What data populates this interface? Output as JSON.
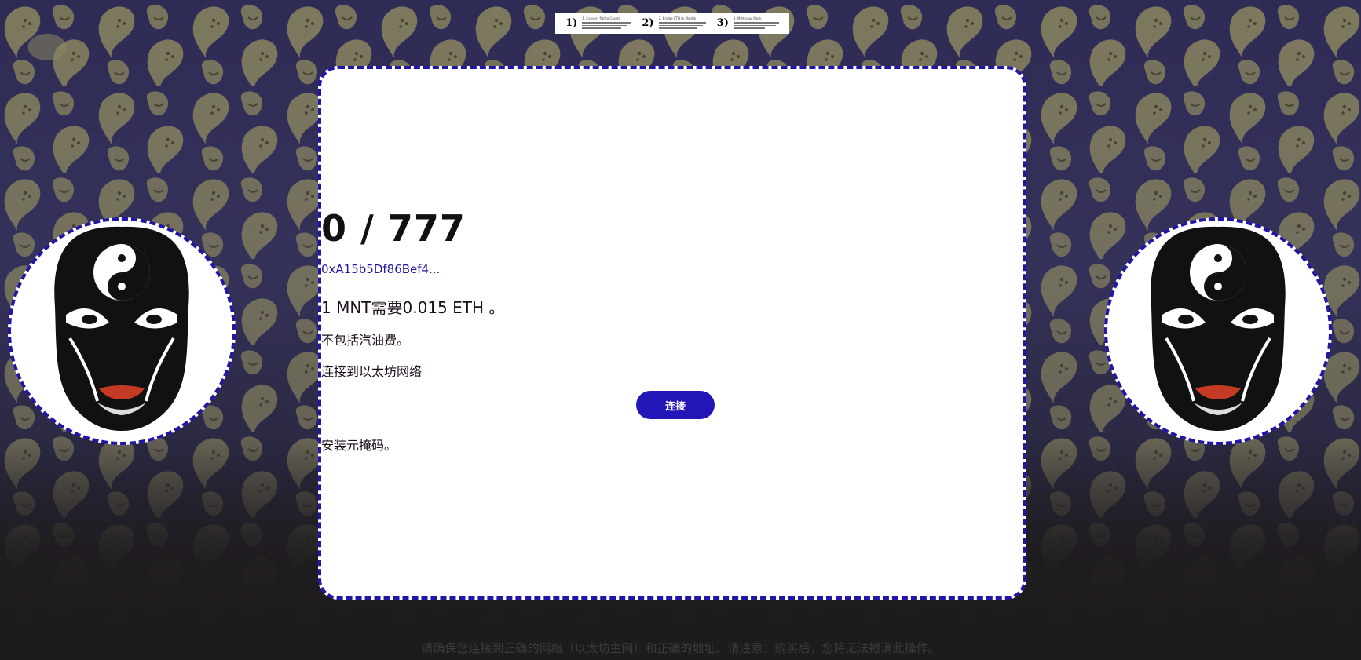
{
  "steps_banner": {
    "steps": [
      {
        "number": "1)",
        "title": "1. Convert fiat to Crypto"
      },
      {
        "number": "2)",
        "title": "2. Bridge ETH to Mantle"
      },
      {
        "number": "3)",
        "title": "3. Mint your Mask"
      }
    ]
  },
  "mint": {
    "count": "0 / 777",
    "contract_address": "0xA15b5Df86Bef4...",
    "price_text": "1 MNT需要0.015 ETH 。",
    "gas_note": "不包括汽油费。",
    "network_prompt": "连接到以太坊网络",
    "connect_label": "连接",
    "install_note": "安装元掩码。"
  },
  "footer": {
    "disclaimer": "请确保您连接到正确的网络（以太坊主网）和正确的地址。请注意：购买后，您将无法撤消此操作。"
  },
  "images": {
    "left_mask": "opera-mask-yin-yang",
    "right_mask": "opera-mask-yin-yang"
  },
  "colors": {
    "accent": "#2216a8",
    "button": "#2216b8",
    "card_bg": "#ffffff",
    "page_bg_top": "#2e2b55",
    "page_bg_bottom": "#1e1b1d",
    "pattern": "#8c875f"
  }
}
